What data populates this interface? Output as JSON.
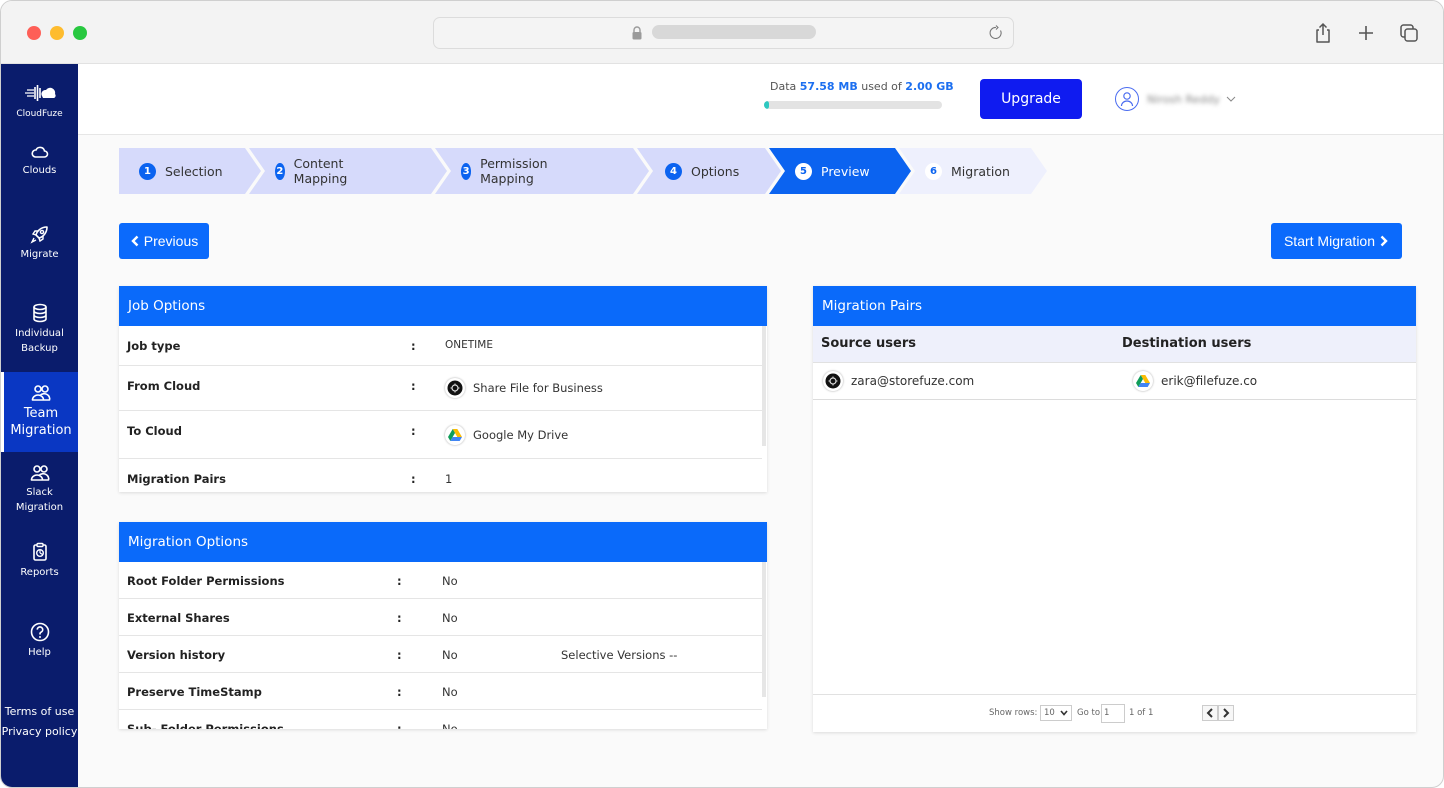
{
  "browser": {
    "address_bar": "",
    "buttons": {
      "share": "share-icon",
      "new_tab": "plus-icon",
      "tabs": "tabs-icon"
    }
  },
  "sidebar": {
    "brand": "CloudFuze",
    "items": [
      {
        "label": "Clouds",
        "icon": "cloud-icon",
        "active": false
      },
      {
        "label": "Migrate",
        "icon": "rocket-icon",
        "active": false
      },
      {
        "label": "Individual Backup",
        "label_lines": [
          "Individual",
          "Backup"
        ],
        "icon": "database-icon",
        "active": false
      },
      {
        "label": "Team Migration",
        "label_lines": [
          "Team",
          "Migration"
        ],
        "icon": "users-icon",
        "active": true
      },
      {
        "label": "Slack Migration",
        "label_lines": [
          "Slack",
          "Migration"
        ],
        "icon": "users-icon",
        "active": false
      },
      {
        "label": "Reports",
        "icon": "clipboard-icon",
        "active": false
      },
      {
        "label": "Help",
        "icon": "help-icon",
        "active": false
      }
    ],
    "links": [
      "Terms of use",
      "Privacy policy"
    ]
  },
  "topbar": {
    "quota_prefix": "Data",
    "quota_used": "57.58 MB",
    "quota_mid": "used of",
    "quota_total": "2.00 GB",
    "quota_fraction": 0.028,
    "upgrade_label": "Upgrade",
    "user_name": "Nirosh Reddy"
  },
  "stepper": {
    "steps": [
      {
        "num": "1",
        "label": "Selection",
        "state": "done"
      },
      {
        "num": "2",
        "label": "Content Mapping",
        "state": "done"
      },
      {
        "num": "3",
        "label": "Permission Mapping",
        "state": "done"
      },
      {
        "num": "4",
        "label": "Options",
        "state": "done"
      },
      {
        "num": "5",
        "label": "Preview",
        "state": "active"
      },
      {
        "num": "6",
        "label": "Migration",
        "state": "future"
      }
    ]
  },
  "actions": {
    "previous_label": "Previous",
    "start_label": "Start Migration"
  },
  "job_options": {
    "title": "Job Options",
    "rows": [
      {
        "key": "Job type",
        "sep": ":",
        "value": "ONETIME"
      },
      {
        "key": "From Cloud",
        "sep": ":",
        "value": "Share File for Business",
        "icon": "sharefile-icon"
      },
      {
        "key": "To Cloud",
        "sep": ":",
        "value": "Google My Drive",
        "icon": "google-drive-icon"
      },
      {
        "key": "Migration Pairs",
        "sep": ":",
        "value": "1"
      }
    ]
  },
  "migration_options": {
    "title": "Migration Options",
    "rows": [
      {
        "key": "Root Folder Permissions",
        "sep": ":",
        "value": "No"
      },
      {
        "key": "External Shares",
        "sep": ":",
        "value": "No"
      },
      {
        "key": "Version history",
        "sep": ":",
        "value": "No",
        "extra": "Selective Versions --"
      },
      {
        "key": "Preserve TimeStamp",
        "sep": ":",
        "value": "No"
      },
      {
        "key": "Sub- Folder Permissions",
        "sep": ":",
        "value": "No"
      }
    ]
  },
  "migration_pairs": {
    "title": "Migration Pairs",
    "columns": [
      "Source users",
      "Destination users"
    ],
    "rows": [
      {
        "source": "zara@storefuze.com",
        "source_icon": "sharefile-icon",
        "destination": "erik@filefuze.co",
        "destination_icon": "google-drive-icon"
      }
    ],
    "footer": {
      "show_rows_label": "Show rows:",
      "rows_value": "10",
      "goto_label": "Go to:",
      "goto_value": "1",
      "page_info": "1 of 1"
    }
  },
  "colors": {
    "sidebar_bg": "#0a1c6c",
    "sidebar_active": "#0a37c3",
    "primary": "#0a6afa",
    "upgrade": "#0f1bf0",
    "step_done": "#d6dafb",
    "step_future": "#eef0fd",
    "quota_fill": "#2ec8c0"
  }
}
